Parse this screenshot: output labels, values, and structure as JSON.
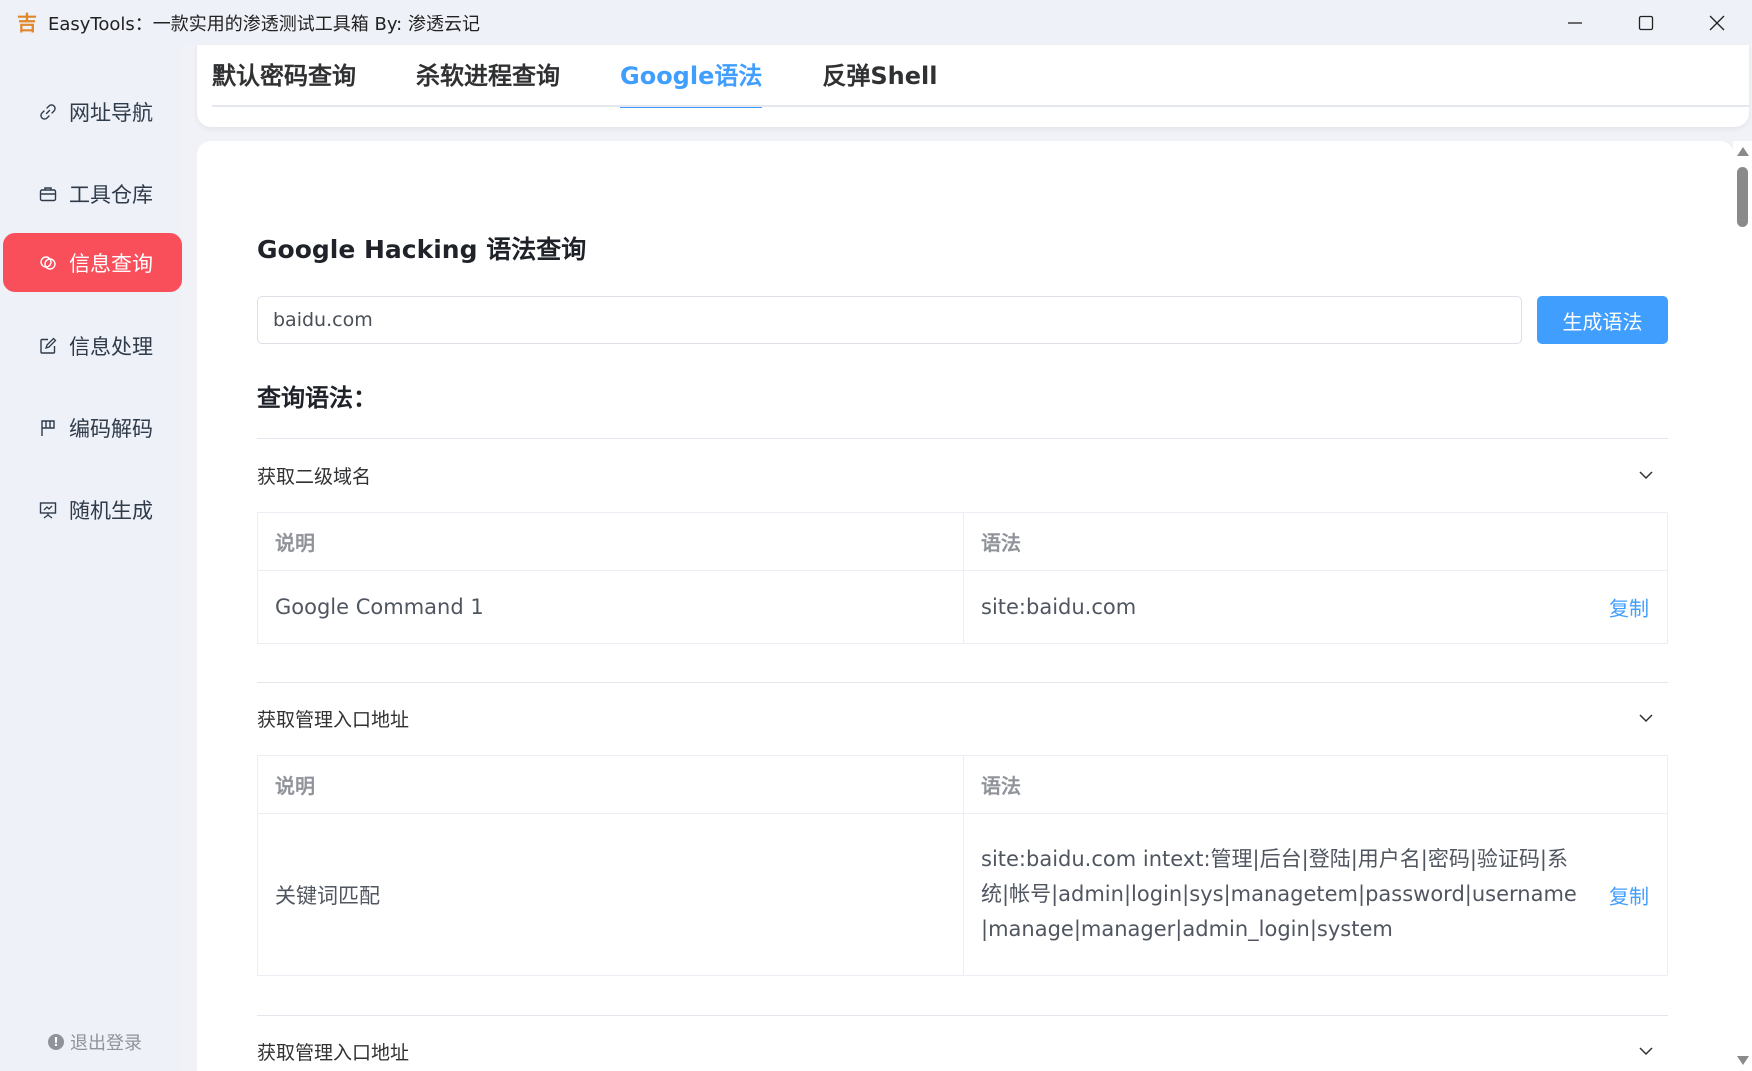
{
  "window": {
    "title": "EasyTools：一款实用的渗透测试工具箱 By: 渗透云记",
    "app_icon_glyph": "吉"
  },
  "sidebar": {
    "items": [
      {
        "label": "网址导航",
        "icon": "link-icon"
      },
      {
        "label": "工具仓库",
        "icon": "briefcase-icon"
      },
      {
        "label": "信息查询",
        "icon": "chat-icon",
        "active": true
      },
      {
        "label": "信息处理",
        "icon": "edit-icon"
      },
      {
        "label": "编码解码",
        "icon": "flag-icon"
      },
      {
        "label": "随机生成",
        "icon": "presentation-icon"
      }
    ],
    "logout_label": "退出登录",
    "active_color": "#f94f5b"
  },
  "tabs": [
    {
      "label": "默认密码查询"
    },
    {
      "label": "杀软进程查询"
    },
    {
      "label": "Google语法",
      "active": true
    },
    {
      "label": "反弹Shell"
    }
  ],
  "main": {
    "title": "Google Hacking 语法查询",
    "search_value": "baidu.com",
    "generate_button": "生成语法",
    "query_label": "查询语法：",
    "accent_color": "#409eff",
    "table_headers": {
      "desc": "说明",
      "syntax": "语法"
    },
    "copy_label": "复制",
    "sections": [
      {
        "title": "获取二级域名",
        "rows": [
          {
            "desc": "Google Command 1",
            "syntax": "site:baidu.com"
          }
        ]
      },
      {
        "title": "获取管理入口地址",
        "rows": [
          {
            "desc": "关键词匹配",
            "syntax": "site:baidu.com intext:管理|后台|登陆|用户名|密码|验证码|系统|帐号|admin|login|sys|managetem|password|username|manage|manager|admin_login|system"
          }
        ]
      },
      {
        "title": "获取管理入口地址"
      }
    ]
  }
}
